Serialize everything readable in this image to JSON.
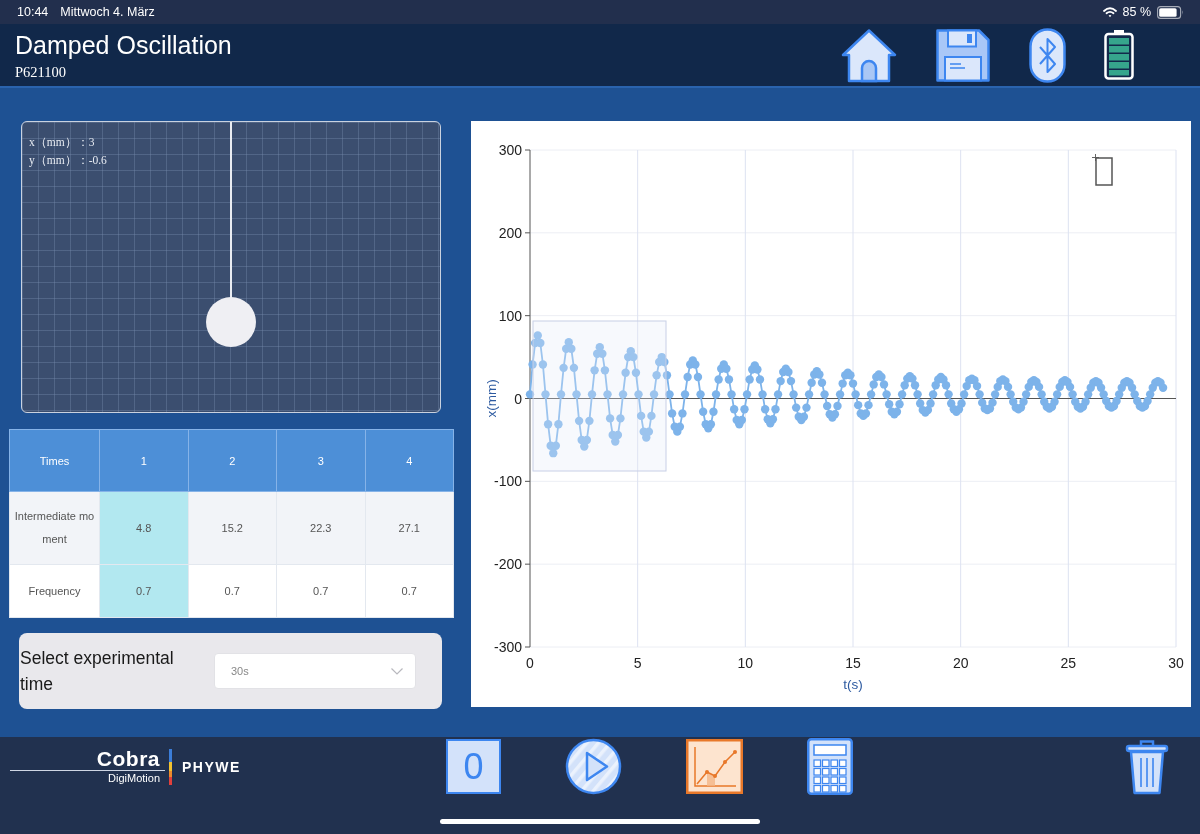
{
  "status_bar": {
    "time": "10:44",
    "date": "Mittwoch 4. März",
    "battery": "85 %"
  },
  "header": {
    "title": "Damped Oscillation",
    "code": "P621100"
  },
  "pendulum": {
    "readouts": [
      "x（mm）：3",
      "y（mm）：-0.6"
    ]
  },
  "table": {
    "corner": "Times",
    "columns": [
      {
        "label": "1",
        "selected": true
      },
      {
        "label": "2",
        "selected": false
      },
      {
        "label": "3",
        "selected": false
      },
      {
        "label": "4",
        "selected": false
      }
    ],
    "rows": [
      {
        "label": "Intermediate moment",
        "values": [
          "4.8",
          "15.2",
          "22.3",
          "27.1"
        ]
      },
      {
        "label": "Frequency",
        "values": [
          "0.7",
          "0.7",
          "0.7",
          "0.7"
        ]
      }
    ]
  },
  "time_select": {
    "label": "Select experimental time",
    "value": "30s"
  },
  "chart": {
    "chart_data": {
      "type": "line",
      "xlabel": "t(s)",
      "ylabel": "x(mm)",
      "grid": true,
      "xlim": [
        0,
        30
      ],
      "ylim": [
        -300,
        300
      ],
      "xticks": [
        0,
        5,
        10,
        15,
        20,
        25,
        30
      ],
      "yticks": [
        -300,
        -200,
        -100,
        0,
        100,
        200,
        300
      ],
      "x": [
        0,
        0.12,
        0.24,
        0.36,
        0.48,
        0.6,
        0.72,
        0.84,
        0.96,
        1.08,
        1.2,
        1.32,
        1.44,
        1.56,
        1.68,
        1.8,
        1.92,
        2.04,
        2.16,
        2.28,
        2.4,
        2.52,
        2.64,
        2.76,
        2.88,
        3,
        3.12,
        3.24,
        3.36,
        3.48,
        3.6,
        3.72,
        3.84,
        3.96,
        4.08,
        4.2,
        4.32,
        4.44,
        4.56,
        4.68,
        4.8,
        4.92,
        5.04,
        5.16,
        5.28,
        5.4,
        5.52,
        5.64,
        5.76,
        5.88,
        6,
        6.12,
        6.24,
        6.36,
        6.48,
        6.6,
        6.72,
        6.84,
        6.96,
        7.08,
        7.2,
        7.32,
        7.44,
        7.56,
        7.68,
        7.8,
        7.92,
        8.04,
        8.16,
        8.28,
        8.4,
        8.52,
        8.64,
        8.76,
        8.88,
        9,
        9.12,
        9.24,
        9.36,
        9.48,
        9.6,
        9.72,
        9.84,
        9.96,
        10.08,
        10.2,
        10.32,
        10.44,
        10.56,
        10.68,
        10.8,
        10.92,
        11.04,
        11.16,
        11.28,
        11.4,
        11.52,
        11.64,
        11.76,
        11.88,
        12,
        12.12,
        12.24,
        12.36,
        12.48,
        12.6,
        12.72,
        12.84,
        12.96,
        13.08,
        13.2,
        13.32,
        13.44,
        13.56,
        13.68,
        13.8,
        13.92,
        14.04,
        14.16,
        14.28,
        14.4,
        14.52,
        14.64,
        14.76,
        14.88,
        15,
        15.12,
        15.24,
        15.36,
        15.48,
        15.6,
        15.72,
        15.84,
        15.96,
        16.08,
        16.2,
        16.32,
        16.44,
        16.56,
        16.68,
        16.8,
        16.92,
        17.04,
        17.16,
        17.28,
        17.4,
        17.52,
        17.64,
        17.76,
        17.88,
        18,
        18.12,
        18.24,
        18.36,
        18.48,
        18.6,
        18.72,
        18.84,
        18.96,
        19.08,
        19.2,
        19.32,
        19.44,
        19.56,
        19.68,
        19.8,
        19.92,
        20.04,
        20.16,
        20.28,
        20.4,
        20.52,
        20.64,
        20.76,
        20.88,
        21,
        21.12,
        21.24,
        21.36,
        21.48,
        21.6,
        21.72,
        21.84,
        21.96,
        22.08,
        22.2,
        22.32,
        22.44,
        22.56,
        22.68,
        22.8,
        22.92,
        23.04,
        23.16,
        23.28,
        23.4,
        23.52,
        23.64,
        23.76,
        23.88,
        24,
        24.12,
        24.24,
        24.36,
        24.48,
        24.6,
        24.72,
        24.84,
        24.96,
        25.08,
        25.2,
        25.32,
        25.44,
        25.56,
        25.68,
        25.8,
        25.92,
        26.04,
        26.16,
        26.28,
        26.4,
        26.52,
        26.64,
        26.76,
        26.88,
        27,
        27.12,
        27.24,
        27.36,
        27.48,
        27.6,
        27.72,
        27.84,
        27.96,
        28.08,
        28.2,
        28.32,
        28.44,
        28.56,
        28.68,
        28.8,
        28.92,
        29.04,
        29.16,
        29.28,
        29.4
      ],
      "series": [
        {
          "color": "#7db3ea",
          "marker": "circle",
          "values": [
            5,
            41,
            67,
            76,
            67,
            41,
            5,
            -31,
            -57,
            -66,
            -57,
            -31,
            5,
            37,
            60,
            68,
            60,
            37,
            5,
            -27,
            -50,
            -58,
            -50,
            -27,
            5,
            34,
            54,
            62,
            54,
            34,
            5,
            -24,
            -44,
            -52,
            -44,
            -24,
            5,
            31,
            50,
            57,
            50,
            31,
            5,
            -21,
            -40,
            -47,
            -40,
            -21,
            5,
            28,
            44,
            50,
            44,
            28,
            5,
            -18,
            -34,
            -40,
            -34,
            -18,
            5,
            26,
            41,
            46,
            41,
            26,
            5,
            -16,
            -31,
            -36,
            -31,
            -16,
            5,
            23,
            36,
            41,
            36,
            23,
            5,
            -13,
            -26,
            -31,
            -26,
            -13,
            5,
            23,
            35,
            40,
            35,
            23,
            5,
            -13,
            -25,
            -30,
            -25,
            -13,
            5,
            21,
            32,
            36,
            32,
            21,
            5,
            -11,
            -22,
            -26,
            -22,
            -11,
            5,
            19,
            29,
            33,
            29,
            19,
            5,
            -9,
            -19,
            -23,
            -19,
            -9,
            5,
            18,
            28,
            31,
            28,
            18,
            5,
            -8,
            -18,
            -21,
            -18,
            -8,
            5,
            17,
            26,
            29,
            26,
            17,
            5,
            -7,
            -16,
            -19,
            -16,
            -7,
            5,
            16,
            24,
            27,
            24,
            16,
            5,
            -6,
            -14,
            -17,
            -14,
            -6,
            5,
            16,
            23,
            26,
            23,
            16,
            5,
            -6,
            -13,
            -16,
            -13,
            -6,
            5,
            15,
            22,
            24,
            22,
            15,
            5,
            -5,
            -12,
            -14,
            -12,
            -5,
            5,
            14,
            21,
            23,
            21,
            14,
            5,
            -4,
            -11,
            -13,
            -11,
            -4,
            5,
            14,
            20,
            22,
            20,
            14,
            5,
            -4,
            -10,
            -12,
            -10,
            -4,
            5,
            14,
            20,
            22,
            20,
            14,
            5,
            -4,
            -10,
            -12,
            -10,
            -4,
            5,
            13,
            19,
            21,
            19,
            13,
            5,
            -3,
            -9,
            -11,
            -9,
            -3,
            5,
            13,
            19,
            21,
            19,
            13,
            5,
            -3,
            -9,
            -11,
            -9,
            -3,
            5,
            13,
            19,
            21,
            19,
            13
          ]
        }
      ]
    }
  },
  "footer": {
    "logo": {
      "wordmark": "Cobra",
      "subtitle": "DigiMotion",
      "brand": "PHYWE"
    },
    "toolbar": [
      {
        "kind": "counter",
        "label": "0",
        "active": false
      },
      {
        "kind": "play",
        "active": false
      },
      {
        "kind": "chart",
        "active": true
      },
      {
        "kind": "calculator",
        "active": false
      },
      {
        "kind": "trash",
        "active": false
      }
    ]
  }
}
